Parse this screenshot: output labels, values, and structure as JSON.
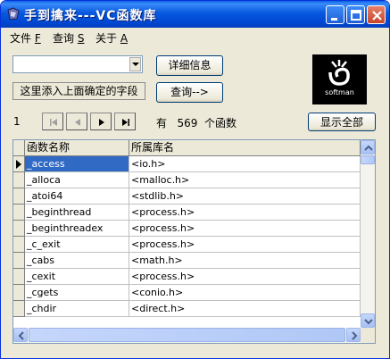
{
  "window": {
    "title": "手到擒来---VC函数库"
  },
  "menu": [
    {
      "label": "文件",
      "accel": "F"
    },
    {
      "label": "查询",
      "accel": "S"
    },
    {
      "label": "关于",
      "accel": "A"
    }
  ],
  "search": {
    "combo_value": "",
    "hint_label": "这里添入上面确定的字段"
  },
  "buttons": {
    "details": "详细信息",
    "query": "查询-->",
    "show_all": "显示全部"
  },
  "logo": {
    "brand": "softman"
  },
  "pager": {
    "current": "1",
    "count_prefix": "有",
    "count": "569",
    "count_suffix": "个函数"
  },
  "table": {
    "columns": [
      "函数名称",
      "所属库名"
    ],
    "selected_row": 0,
    "rows": [
      [
        "_access",
        "<io.h>"
      ],
      [
        "_alloca",
        "<malloc.h>"
      ],
      [
        "_atoi64",
        "<stdlib.h>"
      ],
      [
        "_beginthread",
        "<process.h>"
      ],
      [
        "_beginthreadex",
        "<process.h>"
      ],
      [
        "_c_exit",
        "<process.h>"
      ],
      [
        "_cabs",
        "<math.h>"
      ],
      [
        "_cexit",
        "<process.h>"
      ],
      [
        "_cgets",
        "<conio.h>"
      ],
      [
        "_chdir",
        "<direct.h>"
      ]
    ]
  },
  "colors": {
    "selection": "#316ac5",
    "titlebar": "#0058e0",
    "face": "#ece9d8"
  }
}
